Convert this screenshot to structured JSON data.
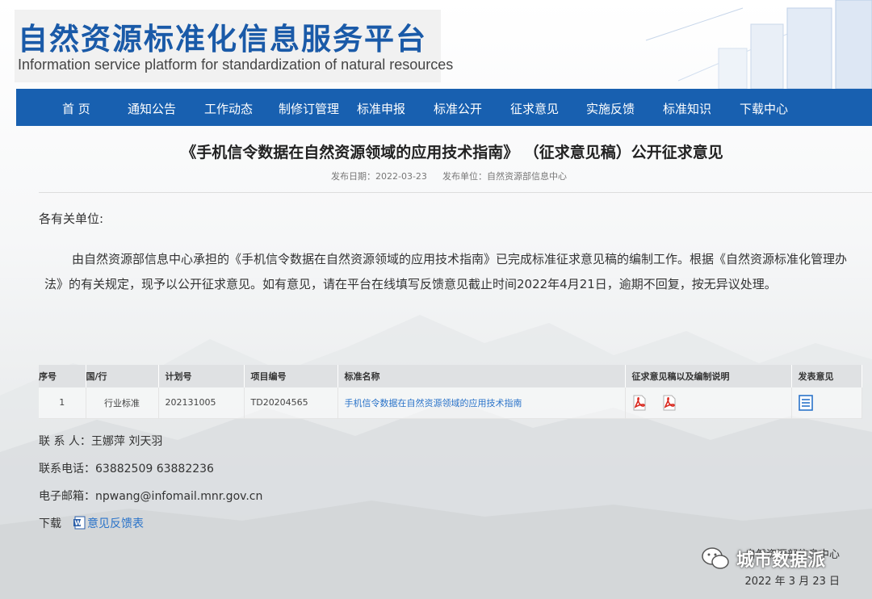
{
  "header": {
    "title_cn": "自然资源标准化信息服务平台",
    "title_en": "Information service platform for standardization of natural resources"
  },
  "nav": {
    "items": [
      "首 页",
      "通知公告",
      "工作动态",
      "制修订管理",
      "标准申报",
      "标准公开",
      "征求意见",
      "实施反馈",
      "标准知识",
      "下载中心"
    ]
  },
  "article": {
    "title": "《手机信令数据在自然资源领域的应用技术指南》 （征求意见稿）公开征求意见",
    "publish_date": "发布日期：2022-03-23",
    "publisher": "发布单位：自然资源部信息中心",
    "greeting": "各有关单位:",
    "body": "由自然资源部信息中心承担的《手机信令数据在自然资源领域的应用技术指南》已完成标准征求意见稿的编制工作。根据《自然资源标准化管理办法》的有关规定，现予以公开征求意见。如有意见，请在平台在线填写反馈意见截止时间2022年4月21日，逾期不回复，按无异议处理。"
  },
  "table": {
    "headers": [
      "序号",
      "国/行",
      "计划号",
      "项目编号",
      "标准名称",
      "征求意见稿以及编制说明",
      "发表意见"
    ],
    "rows": [
      {
        "no": "1",
        "level": "行业标准",
        "plan_no": "202131005",
        "project_no": "TD20204565",
        "name": "手机信令数据在自然资源领域的应用技术指南"
      }
    ]
  },
  "contact": {
    "person": "联 系 人：王娜萍 刘天羽",
    "phone": "联系电话：63882509 63882236",
    "email": "电子邮箱：npwang@infomail.mnr.gov.cn",
    "download_label": "下载",
    "download_link": "意见反馈表"
  },
  "signoff": {
    "org": "自然资源部信息中心",
    "date": "2022 年 3 月 23 日"
  },
  "watermark": {
    "text": "城市数据派"
  },
  "colors": {
    "brand_blue": "#1860b0",
    "logo_blue": "#1a5aa8",
    "link_blue": "#2a73c9",
    "pdf_red": "#d9261c"
  }
}
